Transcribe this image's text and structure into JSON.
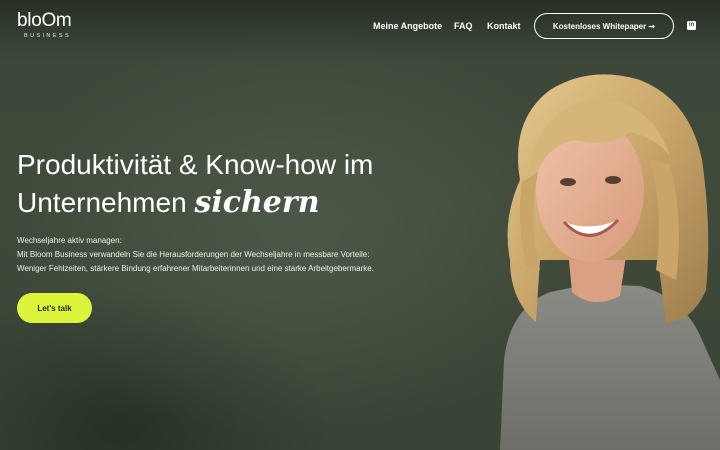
{
  "header": {
    "logo": {
      "word": "bloOm",
      "sub": "BUSINESS"
    },
    "nav": [
      {
        "label": "Meine Angebote"
      },
      {
        "label": "FAQ"
      },
      {
        "label": "Kontakt"
      }
    ],
    "cta_label": "Kostenloses Whitepaper ➞",
    "linkedin_glyph": "in"
  },
  "hero": {
    "headline_line1": "Produktivität & Know-how im",
    "headline_line2_plain": "Unternehmen ",
    "headline_line2_accent": "sichern",
    "description": [
      "Wechseljahre aktiv managen:",
      "Mit Bloom Business verwandeln Sie die Herausforderungen der Wechseljahre in messbare Vorteile:",
      "Weniger Fehlzeiten, stärkere Bindung erfahrener Mitarbeiterinnen und eine starke Arbeitgebermarke."
    ],
    "button_label": "Let's talk"
  },
  "colors": {
    "background": "#3f4a3b",
    "accent_button": "#dcf53a",
    "text": "#ffffff"
  },
  "icons": [
    "linkedin-icon",
    "arrow-right-icon"
  ]
}
